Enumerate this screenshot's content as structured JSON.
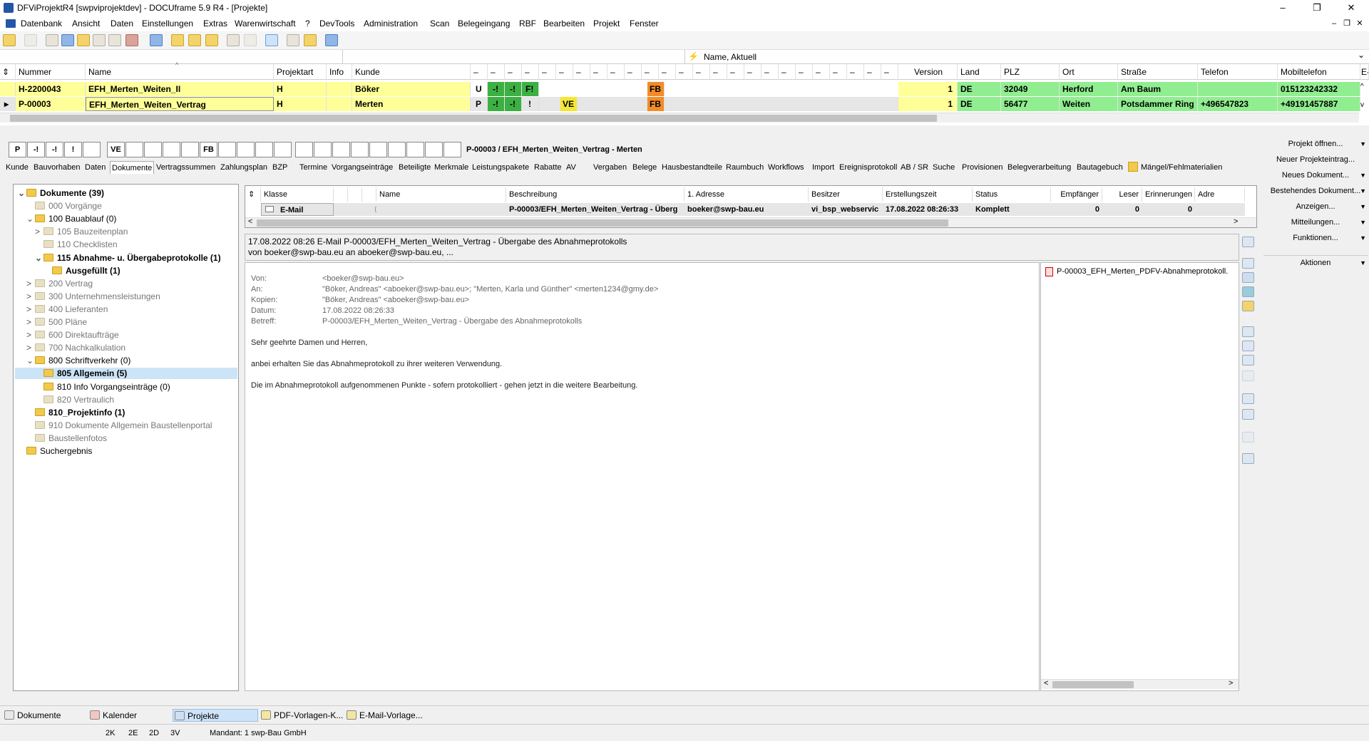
{
  "window": {
    "title": "DFViProjektR4 [swpviprojektdev] - DOCUframe 5.9 R4 - [Projekte]",
    "min": "–",
    "max": "❐",
    "close": "✕",
    "mdi_min": "–",
    "mdi_restore": "❐",
    "mdi_close": "✕"
  },
  "menu": [
    "Datenbank",
    "Ansicht",
    "Daten",
    "Einstellungen",
    "Extras",
    "Warenwirtschaft",
    "?",
    "DevTools",
    "Administration",
    "Scan",
    "Belegeingang",
    "RBF",
    "Bearbeiten",
    "Projekt",
    "Fenster"
  ],
  "filter": {
    "label": "Name, Aktuell",
    "arrow": "⌄"
  },
  "projects": {
    "headers": {
      "sort": "⇕",
      "nummer": "Nummer",
      "name": "Name",
      "projektart": "Projektart",
      "info": "Info",
      "kunde": "Kunde",
      "dash": "–",
      "version": "Version",
      "land": "Land",
      "plz": "PLZ",
      "ort": "Ort",
      "strasse": "Straße",
      "telefon": "Telefon",
      "mobil": "Mobiltelefon",
      "more": "E-"
    },
    "rows": [
      {
        "nummer": "H-2200043",
        "name": "EFH_Merten_Weiten_II",
        "projektart": "H",
        "info": "",
        "kunde": "Böker",
        "s1": "U",
        "s2": "-!",
        "s3": "-!",
        "s4": "F!",
        "s5": "",
        "fb": "FB",
        "version": "1",
        "land": "DE",
        "plz": "32049",
        "ort": "Herford",
        "strasse": "Am Baum",
        "telefon": "",
        "mobil": "015123242332"
      },
      {
        "nummer": "P-00003",
        "name": "EFH_Merten_Weiten_Vertrag",
        "projektart": "H",
        "info": "",
        "kunde": "Merten",
        "s1": "P",
        "s2": "-!",
        "s3": "-!",
        "s4": "!",
        "s5": "VE",
        "fb": "FB",
        "version": "1",
        "land": "DE",
        "plz": "56477",
        "ort": "Weiten",
        "strasse": "Potsdammer Ring",
        "telefon": "+496547823",
        "mobil": "+49191457887"
      }
    ]
  },
  "projectbar": {
    "boxes": [
      "P",
      "-!",
      "-!",
      "!",
      "",
      "VE",
      "",
      "",
      "",
      "",
      "FB"
    ],
    "title": "P-00003 / EFH_Merten_Weiten_Vertrag - Merten"
  },
  "tabs": [
    "Kunde",
    "Bauvorhaben",
    "Daten",
    "Dokumente",
    "Vertragssummen",
    "Zahlungsplan",
    "BZP",
    "Termine",
    "Vorgangseinträge",
    "Beteiligte",
    "Merkmale",
    "Leistungspakete",
    "Rabatte",
    "AV",
    "Vergaben",
    "Belege",
    "Hausbestandteile",
    "Raumbuch",
    "Workflows",
    "Import",
    "Ereignisprotokoll",
    "AB / SR",
    "Suche",
    "Provisionen",
    "Belegverarbeitung",
    "Bautagebuch",
    "Mängel/Fehlmaterialien"
  ],
  "tree": [
    {
      "label": "Dokumente (39)",
      "bold": true,
      "gray": false,
      "level": 0,
      "exp": "⌄"
    },
    {
      "label": "000 Vorgänge",
      "bold": false,
      "gray": true,
      "level": 1,
      "exp": ""
    },
    {
      "label": "100 Bauablauf (0)",
      "bold": false,
      "gray": false,
      "level": 1,
      "exp": "⌄"
    },
    {
      "label": "105 Bauzeitenplan",
      "bold": false,
      "gray": true,
      "level": 2,
      "exp": ">"
    },
    {
      "label": "110 Checklisten",
      "bold": false,
      "gray": true,
      "level": 2,
      "exp": ""
    },
    {
      "label": "115 Abnahme- u. Übergabeprotokolle (1)",
      "bold": true,
      "gray": false,
      "level": 2,
      "exp": "⌄"
    },
    {
      "label": "Ausgefüllt (1)",
      "bold": true,
      "gray": false,
      "level": 3,
      "exp": ""
    },
    {
      "label": "200 Vertrag",
      "bold": false,
      "gray": true,
      "level": 1,
      "exp": ">"
    },
    {
      "label": "300 Unternehmensleistungen",
      "bold": false,
      "gray": true,
      "level": 1,
      "exp": ">"
    },
    {
      "label": "400 Lieferanten",
      "bold": false,
      "gray": true,
      "level": 1,
      "exp": ">"
    },
    {
      "label": "500 Pläne",
      "bold": false,
      "gray": true,
      "level": 1,
      "exp": ">"
    },
    {
      "label": "600 Direktaufträge",
      "bold": false,
      "gray": true,
      "level": 1,
      "exp": ">"
    },
    {
      "label": "700 Nachkalkulation",
      "bold": false,
      "gray": true,
      "level": 1,
      "exp": ">"
    },
    {
      "label": "800 Schriftverkehr (0)",
      "bold": false,
      "gray": false,
      "level": 1,
      "exp": "⌄"
    },
    {
      "label": "805 Allgemein (5)",
      "bold": true,
      "gray": false,
      "level": 2,
      "exp": "",
      "selected": true
    },
    {
      "label": "810 Info Vorgangseinträge (0)",
      "bold": false,
      "gray": false,
      "level": 2,
      "exp": ""
    },
    {
      "label": "820 Vertraulich",
      "bold": false,
      "gray": true,
      "level": 2,
      "exp": ""
    },
    {
      "label": "810_Projektinfo (1)",
      "bold": true,
      "gray": false,
      "level": 1,
      "exp": ""
    },
    {
      "label": "910 Dokumente Allgemein Baustellenportal",
      "bold": false,
      "gray": true,
      "level": 1,
      "exp": ""
    },
    {
      "label": "Baustellenfotos",
      "bold": false,
      "gray": true,
      "level": 1,
      "exp": ""
    },
    {
      "label": "Suchergebnis",
      "bold": false,
      "gray": false,
      "level": 0,
      "exp": ""
    }
  ],
  "docs": {
    "headers": {
      "sort": "⇕",
      "klasse": "Klasse",
      "name": "Name",
      "beschreibung": "Beschreibung",
      "adresse": "1. Adresse",
      "besitzer": "Besitzer",
      "erstellung": "Erstellungszeit",
      "status": "Status",
      "empfaenger": "Empfänger",
      "leser": "Leser",
      "erinnerungen": "Erinnerungen",
      "adr": "Adre"
    },
    "row": {
      "klasse": "E-Mail",
      "name": "",
      "beschreibung": "P-00003/EFH_Merten_Weiten_Vertrag - Überg",
      "adresse": "boeker@swp-bau.eu",
      "besitzer": "vi_bsp_webservic",
      "erstellung": "17.08.2022 08:26:33",
      "status": "Komplett",
      "empfaenger": "0",
      "leser": "0",
      "erinnerungen": "0"
    }
  },
  "mail": {
    "header1": "17.08.2022 08:26 E-Mail P-00003/EFH_Merten_Weiten_Vertrag - Übergabe des Abnahmeprotokolls",
    "header2": "von boeker@swp-bau.eu an aboeker@swp-bau.eu, ...",
    "labels": {
      "von": "Von:",
      "an": "An:",
      "kopien": "Kopien:",
      "datum": "Datum:",
      "betreff": "Betreff:"
    },
    "von": "<boeker@swp-bau.eu>",
    "an": "\"Böker, Andreas\" <aboeker@swp-bau.eu>; \"Merten, Karla und Günther\" <merten1234@gmy.de>",
    "kopien": "\"Böker, Andreas\" <aboeker@swp-bau.eu>",
    "datum": "17.08.2022 08:26:33",
    "betreff": "P-00003/EFH_Merten_Weiten_Vertrag - Übergabe des Abnahmeprotokolls",
    "body1": "Sehr geehrte Damen und Herren,",
    "body2": "anbei erhalten Sie das Abnahmeprotokoll zu ihrer weiteren Verwendung.",
    "body3": "Die im Abnahmeprotokoll aufgenommenen Punkte - sofern protokolliert - gehen jetzt in die weitere Bearbeitung.",
    "attachment": "P-00003_EFH_Merten_PDFV-Abnahmeprotokoll."
  },
  "rightpanel": [
    {
      "label": "Projekt öffnen...",
      "arrow": "▼"
    },
    {
      "label": "Neuer Projekteintrag...",
      "arrow": ""
    },
    {
      "label": "Neues Dokument...",
      "arrow": "▼"
    },
    {
      "label": "Bestehendes Dokument...",
      "arrow": "▼"
    },
    {
      "label": "Anzeigen...",
      "arrow": "▼"
    },
    {
      "label": "Mitteilungen...",
      "arrow": "▼"
    },
    {
      "label": "Funktionen...",
      "arrow": "▼"
    },
    {
      "label": "Aktionen",
      "arrow": "▼"
    }
  ],
  "bottomtabs": [
    "Dokumente",
    "Kalender",
    "Projekte",
    "PDF-Vorlagen-K...",
    "E-Mail-Vorlage..."
  ],
  "status": {
    "k2": "2K",
    "e2": "2E",
    "d2": "2D",
    "v3": "3V",
    "mandant": "Mandant: 1 swp-Bau GmbH"
  },
  "arrows": {
    "left": "<",
    "right": ">",
    "up": "^",
    "down": "v",
    "sortup": "^"
  }
}
